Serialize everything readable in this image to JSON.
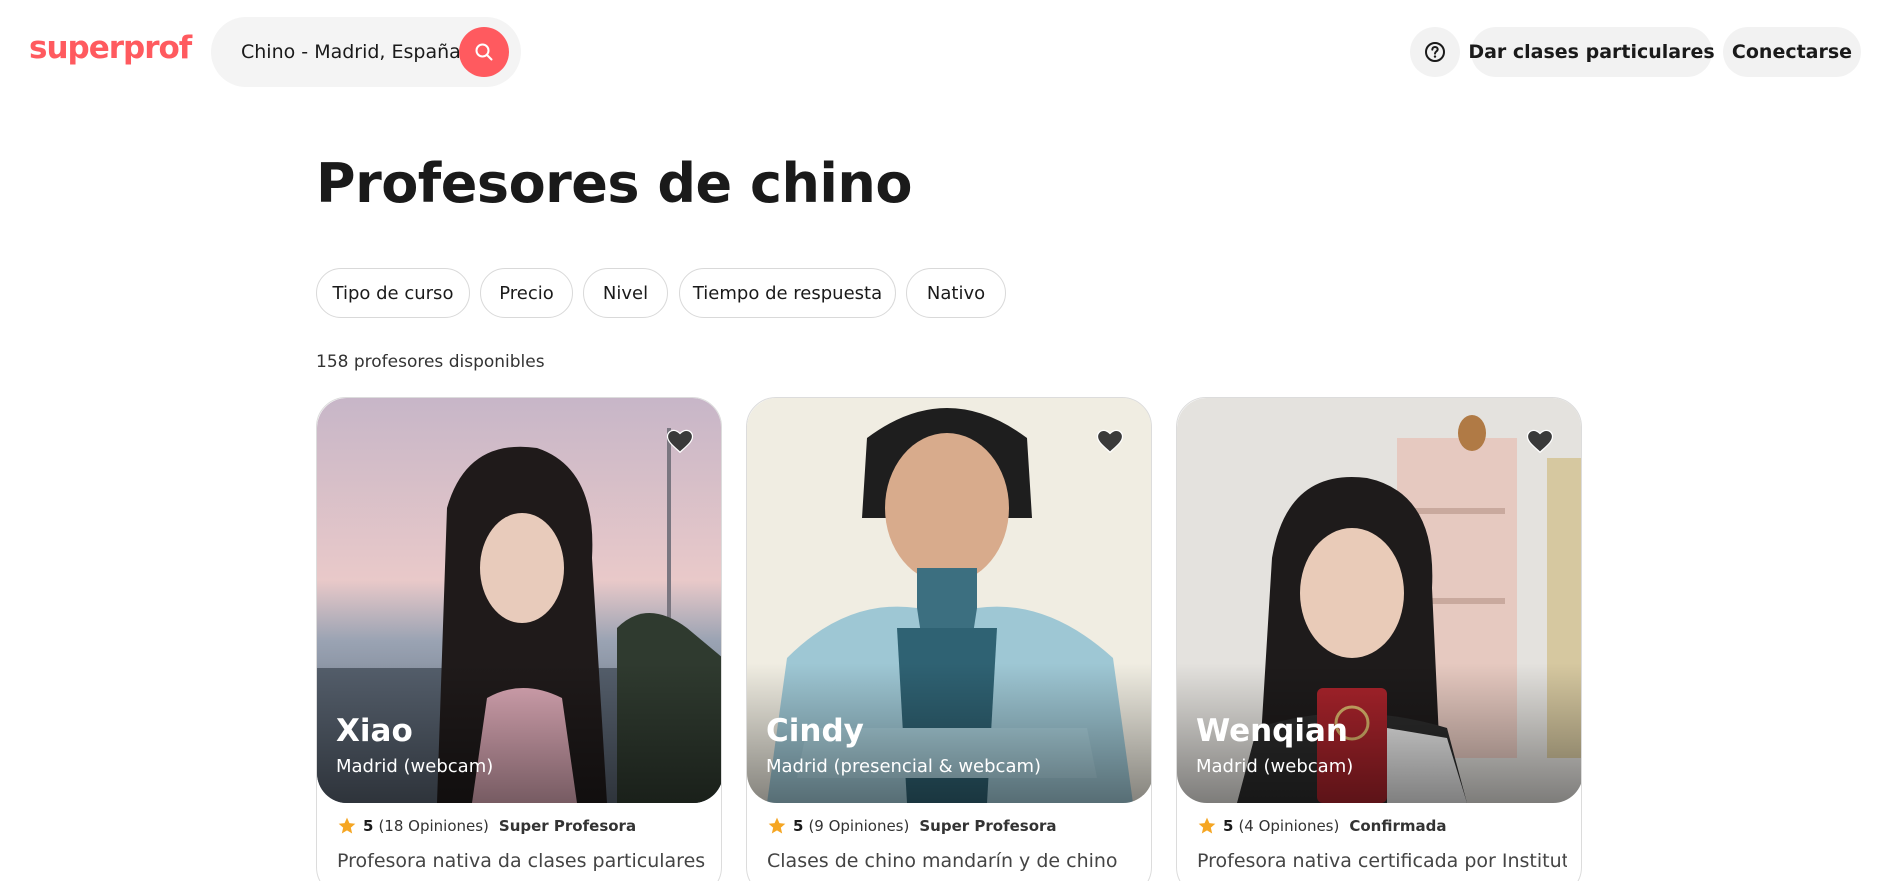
{
  "header": {
    "logo": "superprof",
    "search_value": "Chino - Madrid, España",
    "search_icon": "search-icon",
    "help_icon": "question-circle-icon",
    "teach_label": "Dar clases particulares",
    "login_label": "Conectarse"
  },
  "main": {
    "title": "Profesores de chino",
    "filters": [
      "Tipo de curso",
      "Precio",
      "Nivel",
      "Tiempo de respuesta",
      "Nativo"
    ],
    "count_text": "158 profesores disponibles"
  },
  "teachers": [
    {
      "name": "Xiao",
      "location": "Madrid (webcam)",
      "rating": "5",
      "reviews": "(18 Opiniones)",
      "badge": "Super Profesora",
      "description": "Profesora nativa da clases particulares de"
    },
    {
      "name": "Cindy",
      "location": "Madrid (presencial & webcam)",
      "rating": "5",
      "reviews": "(9 Opiniones)",
      "badge": "Super Profesora",
      "description": "Clases de chino mandarín y de chino"
    },
    {
      "name": "Wenqian",
      "location": "Madrid (webcam)",
      "rating": "5",
      "reviews": "(4 Opiniones)",
      "badge": "Confirmada",
      "description": "Profesora nativa certificada por Instituto"
    }
  ],
  "colors": {
    "brand": "#ff5a5f",
    "star": "#f5a623",
    "pill_bg": "#f2f2f2"
  }
}
